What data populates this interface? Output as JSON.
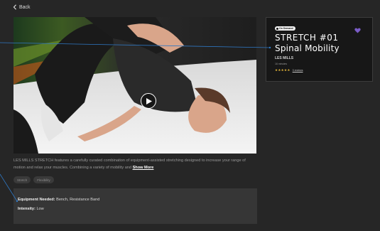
{
  "nav": {
    "back_label": "Back"
  },
  "video": {
    "play_icon": "play-icon"
  },
  "info_card": {
    "badge": "On Demand",
    "title_line1": "STRETCH #01",
    "title_line2": "Spinal Mobility",
    "brand": "LES MILLS",
    "duration": "16 minutes",
    "stars": "★★★★★",
    "reviews": "3 reviews",
    "accent_color": "#7a5cc7"
  },
  "description": {
    "text": "LES MILLS STRETCH features a carefully curated combination of equipment-assisted stretching designed to increase your range of motion and relax your muscles. Combining a variety of mobility and ",
    "show_more": "Show More"
  },
  "tags": [
    "Stretch",
    "Flexibility"
  ],
  "equipment": {
    "needed_label": "Equipment Needed:",
    "needed_value": "Bench, Resistance Band",
    "intensity_label": "Intensity:",
    "intensity_value": "Low"
  },
  "colors": {
    "star": "#e8b93a",
    "callout_line": "#2f78c4"
  }
}
